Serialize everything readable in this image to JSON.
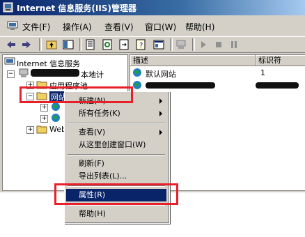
{
  "window": {
    "title": "Internet 信息服务(IIS)管理器"
  },
  "menubar": {
    "items": [
      "文件(F)",
      "操作(A)",
      "查看(V)",
      "窗口(W)",
      "帮助(H)"
    ]
  },
  "tree": {
    "root": "Internet 信息服务",
    "server": "本地计",
    "app_pool": "应用程序池",
    "websites": "网站",
    "web_ext": "Web"
  },
  "list": {
    "columns": [
      "描述",
      "标识符"
    ],
    "rows": [
      {
        "desc": "默认网站",
        "id": "1"
      }
    ]
  },
  "context_menu": {
    "items": [
      {
        "label": "新建(N)",
        "submenu": true
      },
      {
        "label": "所有任务(K)",
        "submenu": true
      },
      {
        "label": "查看(V)",
        "submenu": true
      },
      {
        "label": "从这里创建窗口(W)",
        "submenu": false
      },
      {
        "label": "刷新(F)",
        "submenu": false
      },
      {
        "label": "导出列表(L)...",
        "submenu": false
      },
      {
        "label": "属性(R)",
        "submenu": false,
        "selected": true
      },
      {
        "label": "帮助(H)",
        "submenu": false
      }
    ]
  },
  "colors": {
    "highlight": "#e8202a",
    "selection": "#0a246a",
    "titlebar": "#0a246a"
  }
}
